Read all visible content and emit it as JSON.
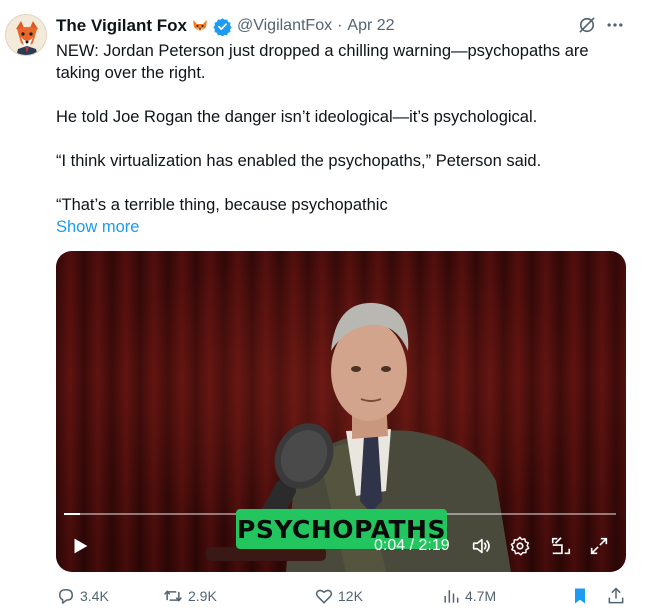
{
  "tweet": {
    "author_name": "The Vigilant Fox",
    "handle": "@VigilantFox",
    "separator": "·",
    "date": "Apr 22",
    "paragraphs": [
      "NEW: Jordan Peterson just dropped a chilling warning—psychopaths are taking over the right.",
      "He told Joe Rogan the danger isn’t ideological—it’s psychological.",
      "“I think virtualization has enabled the psychopaths,” Peterson said.",
      "“That’s a terrible thing, because psychopathic"
    ],
    "show_more": "Show more"
  },
  "video": {
    "caption": "PSYCHOPATHS",
    "time": "0:04 / 2:19",
    "progress": 0.029,
    "caption_color": "#22c55e"
  },
  "actions": {
    "replies": "3.4K",
    "reposts": "2.9K",
    "likes": "12K",
    "views": "4.7M"
  },
  "colors": {
    "accent": "#1d9bf0",
    "secondary_text": "#536471",
    "primary_text": "#0f1419"
  },
  "icons": [
    "avatar-fox",
    "fox-emoji",
    "verified-badge-icon",
    "grok-icon",
    "more-icon",
    "play-icon",
    "volume-icon",
    "settings-icon",
    "minimize-icon",
    "fullscreen-icon",
    "reply-icon",
    "repost-icon",
    "like-icon",
    "views-icon",
    "bookmark-icon",
    "share-icon"
  ]
}
